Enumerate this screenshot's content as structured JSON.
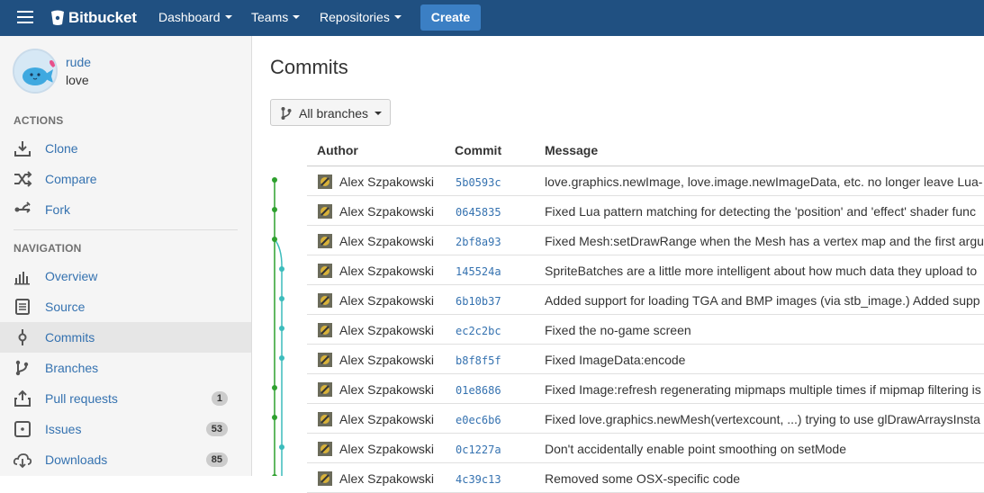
{
  "topbar": {
    "logo_text": "Bitbucket",
    "nav": [
      {
        "label": "Dashboard"
      },
      {
        "label": "Teams"
      },
      {
        "label": "Repositories"
      }
    ],
    "create_label": "Create",
    "bg_color": "#205081"
  },
  "repo": {
    "owner": "rude",
    "name": "love"
  },
  "sidebar": {
    "actions_title": "ACTIONS",
    "actions": [
      {
        "label": "Clone",
        "icon": "download-icon"
      },
      {
        "label": "Compare",
        "icon": "shuffle-icon"
      },
      {
        "label": "Fork",
        "icon": "fork-icon"
      }
    ],
    "navigation_title": "NAVIGATION",
    "navigation": [
      {
        "label": "Overview",
        "icon": "bar-chart-icon"
      },
      {
        "label": "Source",
        "icon": "document-icon"
      },
      {
        "label": "Commits",
        "icon": "commit-icon",
        "active": true
      },
      {
        "label": "Branches",
        "icon": "branch-icon"
      },
      {
        "label": "Pull requests",
        "icon": "pull-request-icon",
        "badge": "1"
      },
      {
        "label": "Issues",
        "icon": "issue-icon",
        "badge": "53"
      },
      {
        "label": "Downloads",
        "icon": "cloud-download-icon",
        "badge": "85"
      }
    ]
  },
  "main": {
    "title": "Commits",
    "branch_filter": "All branches",
    "columns": {
      "author": "Author",
      "commit": "Commit",
      "message": "Message"
    },
    "commits": [
      {
        "author": "Alex Szpakowski",
        "hash": "5b0593c",
        "message": "love.graphics.newImage, love.image.newImageData, etc. no longer leave Lua-"
      },
      {
        "author": "Alex Szpakowski",
        "hash": "0645835",
        "message": "Fixed Lua pattern matching for detecting the 'position' and 'effect' shader func"
      },
      {
        "author": "Alex Szpakowski",
        "hash": "2bf8a93",
        "message": "Fixed Mesh:setDrawRange when the Mesh has a vertex map and the first argu"
      },
      {
        "author": "Alex Szpakowski",
        "hash": "145524a",
        "message": "SpriteBatches are a little more intelligent about how much data they upload to"
      },
      {
        "author": "Alex Szpakowski",
        "hash": "6b10b37",
        "message": "Added support for loading TGA and BMP images (via stb_image.) Added supp"
      },
      {
        "author": "Alex Szpakowski",
        "hash": "ec2c2bc",
        "message": "Fixed the no-game screen"
      },
      {
        "author": "Alex Szpakowski",
        "hash": "b8f8f5f",
        "message": "Fixed ImageData:encode"
      },
      {
        "author": "Alex Szpakowski",
        "hash": "01e8686",
        "message": "Fixed Image:refresh regenerating mipmaps multiple times if mipmap filtering is"
      },
      {
        "author": "Alex Szpakowski",
        "hash": "e0ec6b6",
        "message": "Fixed love.graphics.newMesh(vertexcount, ...) trying to use glDrawArraysInsta"
      },
      {
        "author": "Alex Szpakowski",
        "hash": "0c1227a",
        "message": "Don't accidentally enable point smoothing on setMode"
      },
      {
        "author": "Alex Szpakowski",
        "hash": "4c39c13",
        "message": "Removed some OSX-specific code"
      }
    ],
    "graph_colors": {
      "main": "#2ea02e",
      "branch": "#3cbcbc"
    }
  }
}
